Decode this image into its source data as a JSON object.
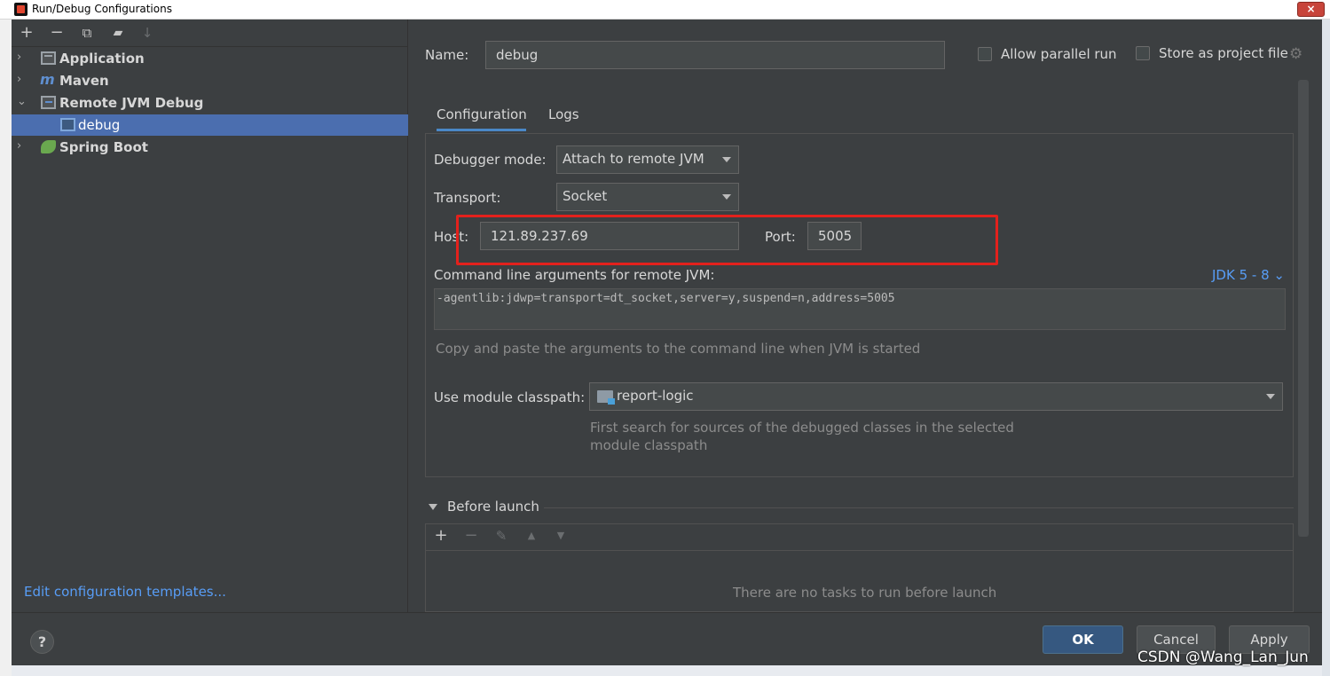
{
  "window": {
    "title": "Run/Debug Configurations",
    "close_label": "×"
  },
  "toolbar": {
    "add": "+",
    "remove": "−",
    "copy": "⧉",
    "folder": "▰",
    "sort": "↓"
  },
  "tree": {
    "items": [
      {
        "label": "Application",
        "icon": "application-icon"
      },
      {
        "label": "Maven",
        "icon": "maven-icon"
      },
      {
        "label": "Remote JVM Debug",
        "icon": "remote-debug-icon"
      },
      {
        "label": "debug",
        "icon": "remote-debug-config-icon",
        "selected": true
      },
      {
        "label": "Spring Boot",
        "icon": "spring-boot-icon"
      }
    ],
    "chevron_collapsed": "›",
    "chevron_expanded": "⌄"
  },
  "edit_templates_link": "Edit configuration templates...",
  "form": {
    "name_label": "Name:",
    "name_value": "debug",
    "allow_parallel_label": "Allow parallel run",
    "store_project_label": "Store as project file",
    "tabs": [
      "Configuration",
      "Logs"
    ],
    "debugger_mode_label": "Debugger mode:",
    "debugger_mode_value": "Attach to remote JVM",
    "transport_label": "Transport:",
    "transport_value": "Socket",
    "host_label": "Host:",
    "host_value": "121.89.237.69",
    "port_label": "Port:",
    "port_value": "5005",
    "cmd_label": "Command line arguments for remote JVM:",
    "jdk_link": "JDK 5 - 8 ⌄",
    "cmd_value": "-agentlib:jdwp=transport=dt_socket,server=y,suspend=n,address=5005",
    "cmd_hint": "Copy and paste the arguments to the command line when JVM is started",
    "module_label": "Use module classpath:",
    "module_value": "report-logic",
    "module_hint_line1": "First search for sources of the debugged classes in the selected",
    "module_hint_line2": "module classpath"
  },
  "before_launch": {
    "title": "Before launch",
    "empty_text": "There are no tasks to run before launch",
    "add": "+",
    "remove": "−",
    "edit": "✎",
    "up": "▲",
    "down": "▼"
  },
  "buttons": {
    "help": "?",
    "ok": "OK",
    "cancel": "Cancel",
    "apply": "Apply"
  },
  "watermark": "CSDN @Wang_Lan_Jun",
  "colors": {
    "accent": "#4b6eaf",
    "link": "#589df6",
    "highlight_box": "#e3211c"
  }
}
